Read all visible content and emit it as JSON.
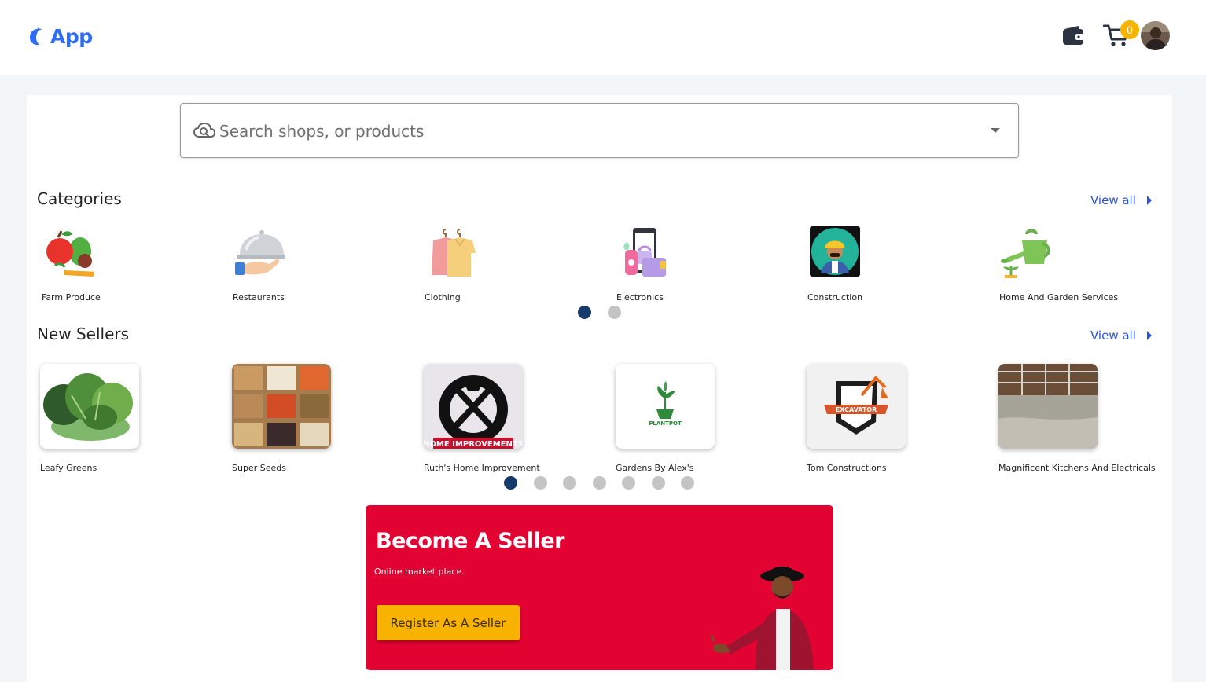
{
  "header": {
    "logo_text": "App",
    "cart_count": "0",
    "icons": {
      "wallet": "wallet-icon",
      "cart": "cart-icon",
      "avatar": "user-avatar"
    }
  },
  "search": {
    "placeholder": "Search shops, or products",
    "icon": "cloud-search-icon"
  },
  "categories": {
    "title": "Categories",
    "view_all": "View all",
    "items": [
      {
        "label": "Farm Produce",
        "icon": "fruit-vegetable-icon"
      },
      {
        "label": "Restaurants",
        "icon": "serving-cloche-icon"
      },
      {
        "label": "Clothing",
        "icon": "shirts-on-hangers-icon"
      },
      {
        "label": "Electronics",
        "icon": "devices-icon"
      },
      {
        "label": "Construction",
        "icon": "construction-worker-icon"
      },
      {
        "label": "Home And Garden Services",
        "icon": "watering-can-icon"
      }
    ],
    "pages": 2,
    "active_page": 1
  },
  "new_sellers": {
    "title": "New Sellers",
    "view_all": "View all",
    "items": [
      {
        "label": "Leafy Greens"
      },
      {
        "label": "Super Seeds"
      },
      {
        "label": "Ruth's Home Improvement",
        "logo_text": "HOME IMPROVEMENTS"
      },
      {
        "label": "Gardens By Alex's",
        "logo_text": "PLANTPOT"
      },
      {
        "label": "Tom Constructions",
        "logo_text": "EXCAVATOR"
      },
      {
        "label": "Magnificent Kitchens And Electricals"
      }
    ],
    "pages": 7,
    "active_page": 1
  },
  "banner": {
    "title": "Become A Seller",
    "subtitle": "Online market place.",
    "button": "Register As A Seller",
    "background": "#e20333",
    "button_color": "#f7b300"
  },
  "colors": {
    "accent": "#2e6cf6",
    "link": "#2952d6",
    "dot_active": "#163a6b",
    "dot_inactive": "#c4c4c4"
  }
}
